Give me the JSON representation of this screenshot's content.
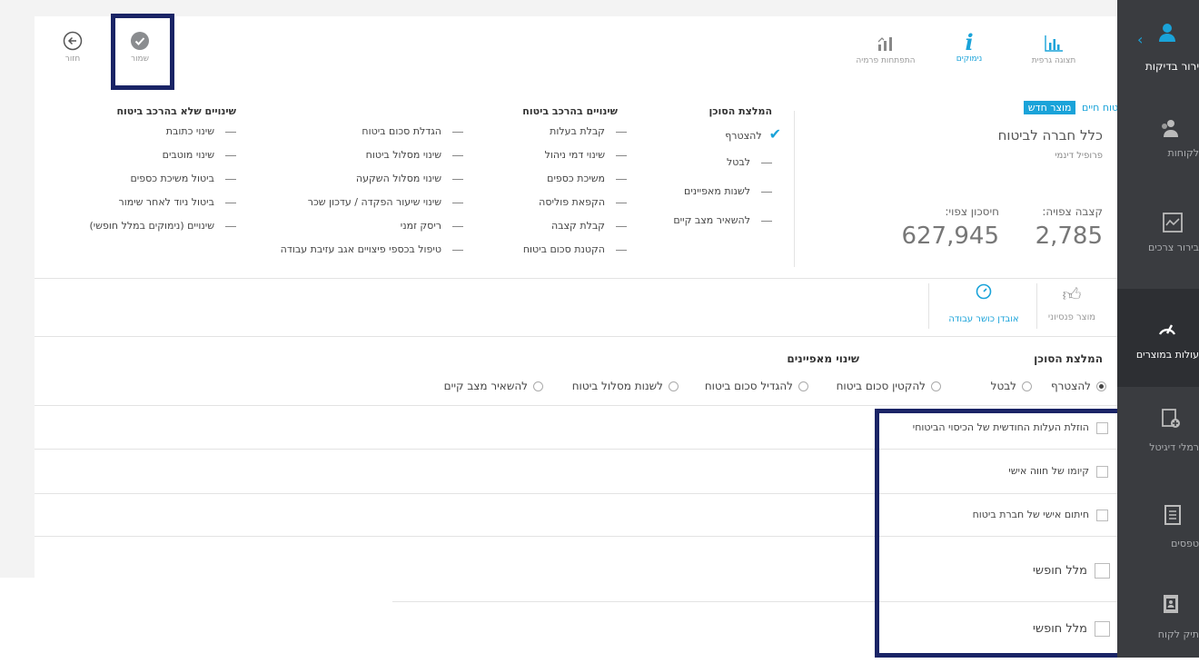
{
  "sidebar": {
    "items": [
      {
        "label": "ירור בדיקות",
        "icon": "user-icon"
      },
      {
        "label": "לקוחות",
        "icon": "users-icon"
      },
      {
        "label": "בירור צרכים",
        "icon": "chart-line-icon"
      },
      {
        "label": "עולות במוצרים",
        "icon": "gauge-icon"
      },
      {
        "label": "רמלי דיגיטל",
        "icon": "form-add-icon"
      },
      {
        "label": "טפסים",
        "icon": "document-icon"
      },
      {
        "label": "תיק לקוח",
        "icon": "contact-book-icon"
      }
    ]
  },
  "toolbar": {
    "back_label": "חזור",
    "save_label": "שמור",
    "graph_label": "תצוגה גרפית",
    "reasons_label": "נימוקים",
    "premium_label": "התפתחות פרמיה"
  },
  "product": {
    "type_label": "ביטוח חיים",
    "new_badge": "מוצר חדש",
    "company": "כלל חברה לביטוח",
    "profile": "פרופיל דינמי",
    "expected_group_label": "קצבה צפויה:",
    "expected_group_value": "2,785",
    "expected_savings_label": "חיסכון צפוי:",
    "expected_savings_value": "627,945"
  },
  "agent_recommendation": {
    "title": "המלצת הסוכן",
    "items": [
      "להצטרף",
      "לבטל",
      "לשנות מאפיינים",
      "להשאיר מצב קיים"
    ],
    "checked_index": 0
  },
  "changes_in_coverage": {
    "title": "שינויים בהרכב ביטוח",
    "col1": [
      "קבלת בעלות",
      "שינוי דמי ניהול",
      "משיכת כספים",
      "הקפאת פוליסה",
      "קבלת קצבה",
      "הקטנת סכום ביטוח"
    ],
    "col2": [
      "הגדלת סכום ביטוח",
      "שינוי מסלול ביטוח",
      "שינוי מסלול השקעה",
      "שינוי שיעור הפקדה / עדכון שכר",
      "ריסק זמני",
      "טיפול בכספי פיצויים אגב עזיבת עבודה"
    ]
  },
  "changes_no_coverage": {
    "title": "שינויים שלא בהרכב ביטוח",
    "items": [
      "שינוי כתובת",
      "שינוי מוטבים",
      "ביטול משיכת כספים",
      "ביטול ניוד לאחר שימור",
      "שינויים (נימוקים במלל חופשי)"
    ]
  },
  "product_tabs": {
    "pension": "מוצר פנסיוני",
    "loss_of_work": "אובדן כושר עבודה"
  },
  "form": {
    "recommendation_title": "המלצת הסוכן",
    "characteristics_title": "שינוי מאפיינים",
    "options": [
      "להצטרף",
      "לבטל",
      "להקטין סכום ביטוח",
      "להגדיל סכום ביטוח",
      "לשנות מסלול ביטוח",
      "להשאיר מצב קיים"
    ],
    "selected_index": 0,
    "checkboxes": [
      "הוזלת העלות החודשית של הכיסוי הביטוחי",
      "קיומו של חווה אישי",
      "חיתום אישי של חברת ביטוח"
    ],
    "free_text": [
      "מלל חופשי",
      "מלל חופשי"
    ]
  },
  "colors": {
    "accent": "#1aa3d9",
    "highlight_box": "#1a2466",
    "sidebar": "#3a3c40"
  }
}
